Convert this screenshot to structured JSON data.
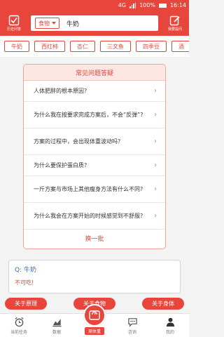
{
  "status_bar": {
    "network": "4G",
    "battery": "100%",
    "time": "16:14"
  },
  "header": {
    "left_button_label": "历史问答",
    "right_button_label": "我要提问",
    "search_category": "食物",
    "search_value": "牛奶"
  },
  "chips": [
    "牛奶",
    "西红柿",
    "杏仁",
    "三文鱼",
    "四季豆",
    "酒"
  ],
  "faq": {
    "title": "常见问题答疑",
    "items": [
      "人体肥胖的根本原因?",
      "为什么我在按要求完成方案后，不会“反弹”?",
      "方案的过程中，会出现体重波动吗?",
      "为什么要保护蛋白质?",
      "一斤方案与市场上其他瘦身方法有什么不同?",
      "为什么我会在方案开始的时候感觉到不舒服?"
    ],
    "more_label": "换一批"
  },
  "chat": {
    "question": "Q: 牛奶",
    "answer": "不可吃!"
  },
  "actions": [
    "关于原理",
    "关于食物",
    "关于身体"
  ],
  "tabs": {
    "task": "当前任务",
    "data": "数据",
    "center": "测体重",
    "consult": "咨询",
    "me": "我的"
  },
  "colors": {
    "accent": "#e8463d"
  }
}
